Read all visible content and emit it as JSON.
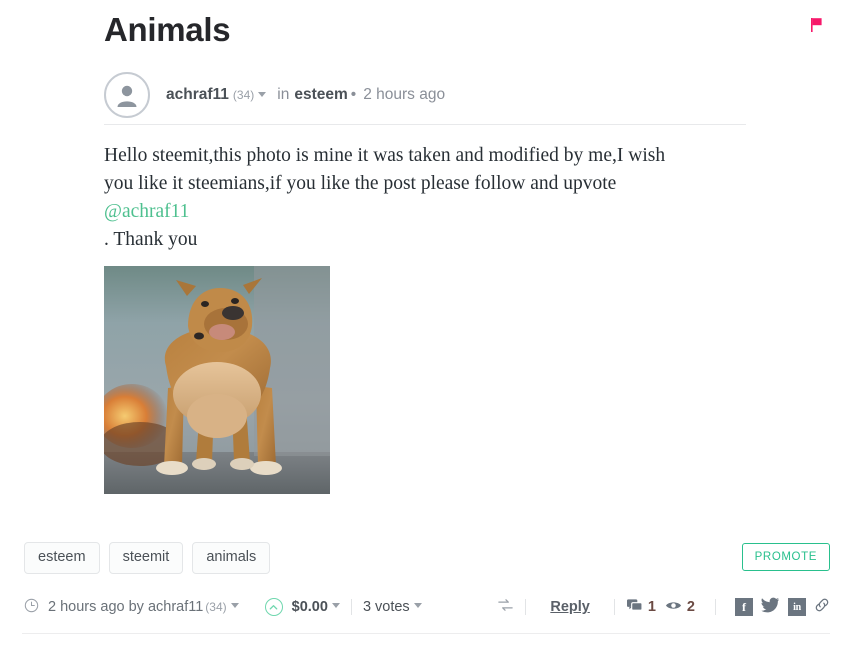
{
  "post": {
    "title": "Animals",
    "author": "achraf11",
    "author_reputation": "(34)",
    "in_label": "in",
    "category": "esteem",
    "separator": "•",
    "time_ago": "2 hours ago",
    "body_line1": "Hello steemit,this photo is mine it was taken and modified by me,I wish",
    "body_line2": "you like it steemians,if you like the post please follow and upvote",
    "mention": "@achraf11",
    "body_line3": ". Thank you",
    "image_alt": "muscular brown american bully dog standing on pavement"
  },
  "flag": {
    "icon": "flag-icon",
    "color": "#f7186a"
  },
  "tags": [
    {
      "label": "esteem"
    },
    {
      "label": "steemit"
    },
    {
      "label": "animals"
    }
  ],
  "promote": {
    "label": "PROMOTE",
    "color": "#29c08d"
  },
  "footer": {
    "clock_icon": "clock-icon",
    "time_ago": "2 hours ago by",
    "author": "achraf11",
    "author_reputation": "(34)",
    "upvote_icon": "upvote-chevron-icon",
    "payout": "$0.00",
    "votes": "3 votes",
    "resteem_icon": "resteem-icon",
    "reply_label": "Reply",
    "comment_icon": "comment-icon",
    "comment_count": "1",
    "views_icon": "eye-icon",
    "views_count": "2",
    "social": [
      {
        "name": "facebook-icon",
        "glyph": "f"
      },
      {
        "name": "twitter-icon",
        "glyph": ""
      },
      {
        "name": "linkedin-icon",
        "glyph": "in"
      },
      {
        "name": "link-icon",
        "glyph": ""
      }
    ]
  },
  "colors": {
    "accent_green": "#29c08d",
    "mention_green": "#4ec08f",
    "flag_pink": "#f7186a",
    "text_dark": "#26272b",
    "text_muted": "#8a8f98"
  }
}
